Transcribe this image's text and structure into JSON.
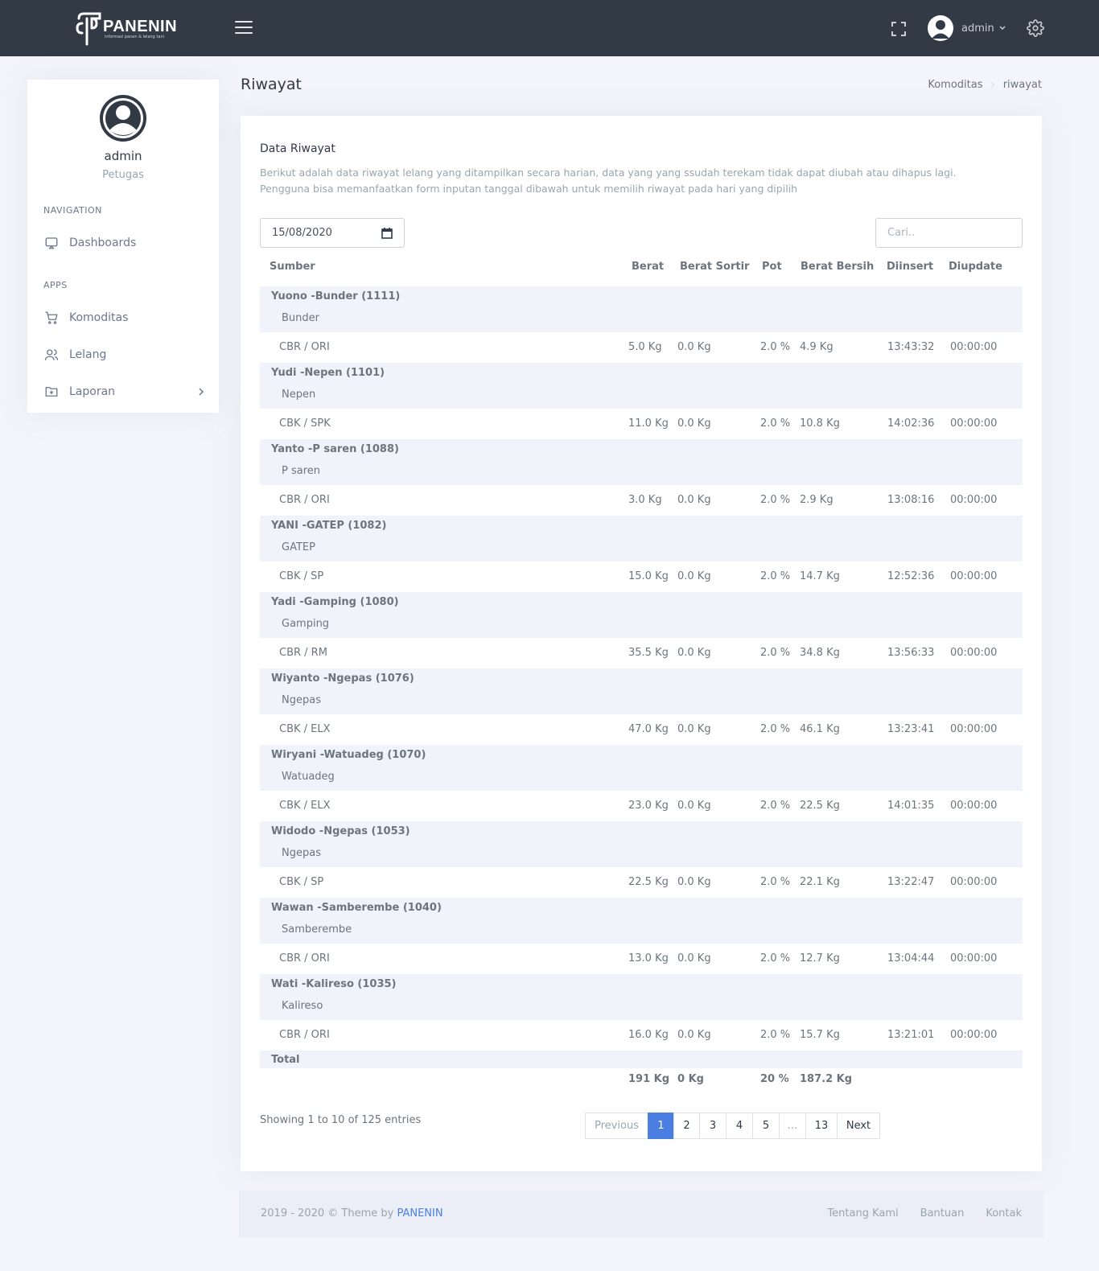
{
  "brand": {
    "name": "PANENIN",
    "tagline": "informasi panen & lelang tani"
  },
  "topbar": {
    "user_name": "admin"
  },
  "sidebar": {
    "user_name": "admin",
    "user_role": "Petugas",
    "nav_title": "Navigation",
    "apps_title": "Apps",
    "items": [
      {
        "label": "Dashboards",
        "icon": "monitor-icon"
      },
      {
        "label": "Komoditas",
        "icon": "cart-icon"
      },
      {
        "label": "Lelang",
        "icon": "users-icon"
      },
      {
        "label": "Laporan",
        "icon": "folder-plus-icon"
      }
    ]
  },
  "page": {
    "title": "Riwayat",
    "breadcrumb": [
      "Komoditas",
      "riwayat"
    ]
  },
  "card": {
    "title": "Data Riwayat",
    "description_line1": "Berikut adalah data riwayat lelang yang ditampilkan secara harian, data yang yang ssudah terekam tidak dapat diubah atau dihapus lagi.",
    "description_line2": "Pengguna bisa memanfaatkan form inputan tanggal dibawah untuk memilih riwayat pada hari yang dipilih",
    "date_value": "15/08/2020",
    "search_placeholder": "Cari.."
  },
  "table": {
    "headers": [
      "Sumber",
      "Berat",
      "Berat Sortir",
      "Pot",
      "Berat Bersih",
      "Diinsert",
      "Diupdate"
    ],
    "groups": [
      {
        "title": "Yuono -Bunder (1111)",
        "sub": "Bunder",
        "row": [
          "CBR / ORI",
          "5.0 Kg",
          "0.0 Kg",
          "2.0 %",
          "4.9 Kg",
          "13:43:32",
          "00:00:00"
        ]
      },
      {
        "title": "Yudi -Nepen (1101)",
        "sub": "Nepen",
        "row": [
          "CBK / SPK",
          "11.0 Kg",
          "0.0 Kg",
          "2.0 %",
          "10.8 Kg",
          "14:02:36",
          "00:00:00"
        ]
      },
      {
        "title": "Yanto -P saren (1088)",
        "sub": "P saren",
        "row": [
          "CBR / ORI",
          "3.0 Kg",
          "0.0 Kg",
          "2.0 %",
          "2.9 Kg",
          "13:08:16",
          "00:00:00"
        ]
      },
      {
        "title": "YANI -GATEP (1082)",
        "sub": "GATEP",
        "row": [
          "CBK / SP",
          "15.0 Kg",
          "0.0 Kg",
          "2.0 %",
          "14.7 Kg",
          "12:52:36",
          "00:00:00"
        ]
      },
      {
        "title": "Yadi -Gamping (1080)",
        "sub": "Gamping",
        "row": [
          "CBR / RM",
          "35.5 Kg",
          "0.0 Kg",
          "2.0 %",
          "34.8 Kg",
          "13:56:33",
          "00:00:00"
        ]
      },
      {
        "title": "Wiyanto -Ngepas (1076)",
        "sub": "Ngepas",
        "row": [
          "CBK / ELX",
          "47.0 Kg",
          "0.0 Kg",
          "2.0 %",
          "46.1 Kg",
          "13:23:41",
          "00:00:00"
        ]
      },
      {
        "title": "Wiryani -Watuadeg (1070)",
        "sub": "Watuadeg",
        "row": [
          "CBK / ELX",
          "23.0 Kg",
          "0.0 Kg",
          "2.0 %",
          "22.5 Kg",
          "14:01:35",
          "00:00:00"
        ]
      },
      {
        "title": "Widodo -Ngepas (1053)",
        "sub": "Ngepas",
        "row": [
          "CBK / SP",
          "22.5 Kg",
          "0.0 Kg",
          "2.0 %",
          "22.1 Kg",
          "13:22:47",
          "00:00:00"
        ]
      },
      {
        "title": "Wawan -Samberembe (1040)",
        "sub": "Samberembe",
        "row": [
          "CBR / ORI",
          "13.0 Kg",
          "0.0 Kg",
          "2.0 %",
          "12.7 Kg",
          "13:04:44",
          "00:00:00"
        ]
      },
      {
        "title": "Wati -Kalireso (1035)",
        "sub": "Kalireso",
        "row": [
          "CBR / ORI",
          "16.0 Kg",
          "0.0 Kg",
          "2.0 %",
          "15.7 Kg",
          "13:21:01",
          "00:00:00"
        ]
      }
    ],
    "total_label": "Total",
    "totals": {
      "berat": "191 Kg",
      "sortir": "0 Kg",
      "pot": "20 %",
      "bersih": "187.2 Kg"
    }
  },
  "pagination": {
    "info": "Showing 1 to 10 of 125 entries",
    "previous": "Previous",
    "pages": [
      "1",
      "2",
      "3",
      "4",
      "5",
      "…",
      "13"
    ],
    "next": "Next",
    "active_page": "1"
  },
  "footer": {
    "copyright": "2019 - 2020 © Theme by",
    "brand": "PANENIN",
    "links": [
      "Tentang Kami",
      "Bantuan",
      "Kontak"
    ]
  },
  "colors": {
    "topbar": "#323a46",
    "accent": "#4a7ee0",
    "row_alt": "#f1f3fa"
  }
}
